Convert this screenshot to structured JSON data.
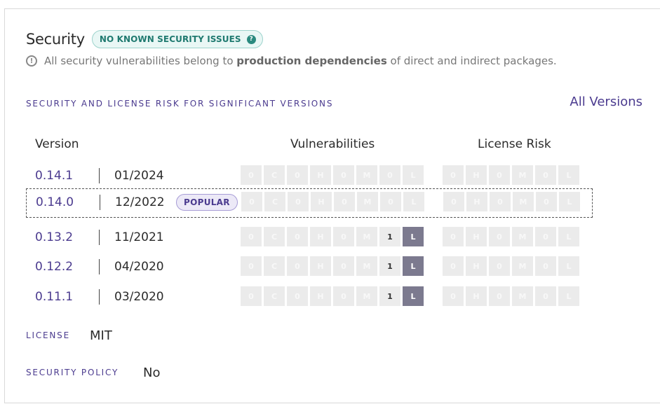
{
  "security": {
    "title": "Security",
    "badge": "NO KNOWN SECURITY ISSUES",
    "badge_icon": "question-icon",
    "note_pre": "All security vulnerabilities belong to ",
    "note_bold": "production dependencies",
    "note_post": " of direct and indirect packages.",
    "note_icon": "info-icon"
  },
  "risk": {
    "section_label": "SECURITY AND LICENSE RISK FOR SIGNIFICANT VERSIONS",
    "all_versions": "All Versions",
    "col_version": "Version",
    "col_vulns": "Vulnerabilities",
    "col_license": "License Risk",
    "popular_label": "POPULAR",
    "rows": [
      {
        "version": "0.14.1",
        "date": "01/2024",
        "popular": false,
        "vulns": [
          {
            "n": "0",
            "l": "C"
          },
          {
            "n": "0",
            "l": "H"
          },
          {
            "n": "0",
            "l": "M"
          },
          {
            "n": "0",
            "l": "L"
          }
        ],
        "license": [
          {
            "n": "0",
            "l": "H"
          },
          {
            "n": "0",
            "l": "M"
          },
          {
            "n": "0",
            "l": "L"
          }
        ]
      },
      {
        "version": "0.14.0",
        "date": "12/2022",
        "popular": true,
        "vulns": [
          {
            "n": "0",
            "l": "C"
          },
          {
            "n": "0",
            "l": "H"
          },
          {
            "n": "0",
            "l": "M"
          },
          {
            "n": "0",
            "l": "L"
          }
        ],
        "license": [
          {
            "n": "0",
            "l": "H"
          },
          {
            "n": "0",
            "l": "M"
          },
          {
            "n": "0",
            "l": "L"
          }
        ]
      },
      {
        "version": "0.13.2",
        "date": "11/2021",
        "popular": false,
        "vulns": [
          {
            "n": "0",
            "l": "C"
          },
          {
            "n": "0",
            "l": "H"
          },
          {
            "n": "0",
            "l": "M"
          },
          {
            "n": "1",
            "l": "L"
          }
        ],
        "license": [
          {
            "n": "0",
            "l": "H"
          },
          {
            "n": "0",
            "l": "M"
          },
          {
            "n": "0",
            "l": "L"
          }
        ]
      },
      {
        "version": "0.12.2",
        "date": "04/2020",
        "popular": false,
        "vulns": [
          {
            "n": "0",
            "l": "C"
          },
          {
            "n": "0",
            "l": "H"
          },
          {
            "n": "0",
            "l": "M"
          },
          {
            "n": "1",
            "l": "L"
          }
        ],
        "license": [
          {
            "n": "0",
            "l": "H"
          },
          {
            "n": "0",
            "l": "M"
          },
          {
            "n": "0",
            "l": "L"
          }
        ]
      },
      {
        "version": "0.11.1",
        "date": "03/2020",
        "popular": false,
        "vulns": [
          {
            "n": "0",
            "l": "C"
          },
          {
            "n": "0",
            "l": "H"
          },
          {
            "n": "0",
            "l": "M"
          },
          {
            "n": "1",
            "l": "L"
          }
        ],
        "license": [
          {
            "n": "0",
            "l": "H"
          },
          {
            "n": "0",
            "l": "M"
          },
          {
            "n": "0",
            "l": "L"
          }
        ]
      }
    ]
  },
  "license": {
    "label": "LICENSE",
    "value": "MIT"
  },
  "policy": {
    "label": "SECURITY POLICY",
    "value": "No"
  },
  "colors": {
    "accent": "#4b3b8f",
    "badge_green": "#1f7a70",
    "active_cell": "#7c7a8f",
    "inactive_cell": "#ebebeb"
  }
}
